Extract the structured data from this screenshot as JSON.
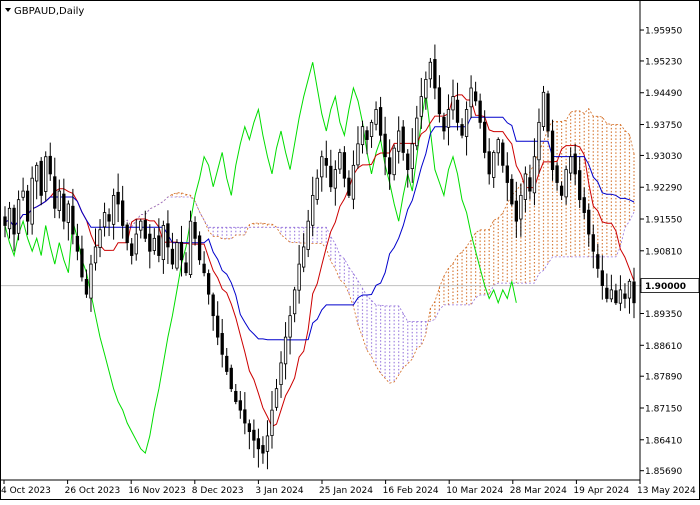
{
  "header": {
    "symbol_label": "GBPAUD,Daily",
    "menu_icon": "triangle-down-icon"
  },
  "chart_data": {
    "type": "candlestick",
    "symbol": "GBPAUD",
    "timeframe": "Daily",
    "indicator": "Ichimoku Kinko Hyo",
    "grid": false,
    "ylim": [
      1.8559,
      1.963
    ],
    "y_ticks": [
      "1.95950",
      "1.95230",
      "1.94490",
      "1.93750",
      "1.93030",
      "1.92290",
      "1.91550",
      "1.90810",
      "1.90000",
      "1.89350",
      "1.88610",
      "1.87890",
      "1.87150",
      "1.86410",
      "1.85690"
    ],
    "current_price_label": "1.90000",
    "current_price": 1.9,
    "x_ticks": [
      "4 Oct 2023",
      "26 Oct 2023",
      "16 Nov 2023",
      "8 Dec 2023",
      "3 Jan 2024",
      "25 Jan 2024",
      "16 Feb 2024",
      "10 Mar 2024",
      "28 Mar 2024",
      "19 Apr 2024",
      "13 May 2024"
    ],
    "colors": {
      "candle": "#000000",
      "tenkan": "#cc0000",
      "kijun": "#0000cc",
      "chikou": "#00dd00",
      "cloud": "#d2691e",
      "cloud_alt": "#9370db",
      "price_line": "#c0c0c0"
    },
    "close": [
      1.914,
      1.918,
      1.912,
      1.92,
      1.922,
      1.915,
      1.925,
      1.928,
      1.921,
      1.93,
      1.926,
      1.918,
      1.922,
      1.915,
      1.919,
      1.912,
      1.908,
      1.902,
      1.898,
      1.905,
      1.909,
      1.913,
      1.917,
      1.915,
      1.921,
      1.919,
      1.914,
      1.91,
      1.907,
      1.912,
      1.915,
      1.911,
      1.908,
      1.911,
      1.907,
      1.914,
      1.909,
      1.905,
      1.91,
      1.906,
      1.903,
      1.915,
      1.911,
      1.906,
      1.903,
      1.898,
      1.893,
      1.888,
      1.884,
      1.88,
      1.876,
      1.873,
      1.871,
      1.868,
      1.866,
      1.864,
      1.862,
      1.861,
      1.865,
      1.871,
      1.876,
      1.882,
      1.888,
      1.893,
      1.899,
      1.905,
      1.909,
      1.915,
      1.921,
      1.925,
      1.93,
      1.928,
      1.923,
      1.927,
      1.931,
      1.925,
      1.921,
      1.928,
      1.933,
      1.937,
      1.934,
      1.938,
      1.941,
      1.935,
      1.93,
      1.926,
      1.932,
      1.936,
      1.931,
      1.927,
      1.933,
      1.939,
      1.944,
      1.948,
      1.952,
      1.946,
      1.94,
      1.936,
      1.941,
      1.944,
      1.938,
      1.935,
      1.941,
      1.946,
      1.943,
      1.938,
      1.931,
      1.926,
      1.931,
      1.934,
      1.928,
      1.924,
      1.919,
      1.915,
      1.921,
      1.926,
      1.922,
      1.93,
      1.938,
      1.945,
      1.936,
      1.927,
      1.924,
      1.921,
      1.927,
      1.93,
      1.926,
      1.92,
      1.917,
      1.912,
      1.908,
      1.904,
      1.9,
      1.897,
      1.899,
      1.896,
      1.899,
      1.897,
      1.901,
      1.896
    ]
  }
}
